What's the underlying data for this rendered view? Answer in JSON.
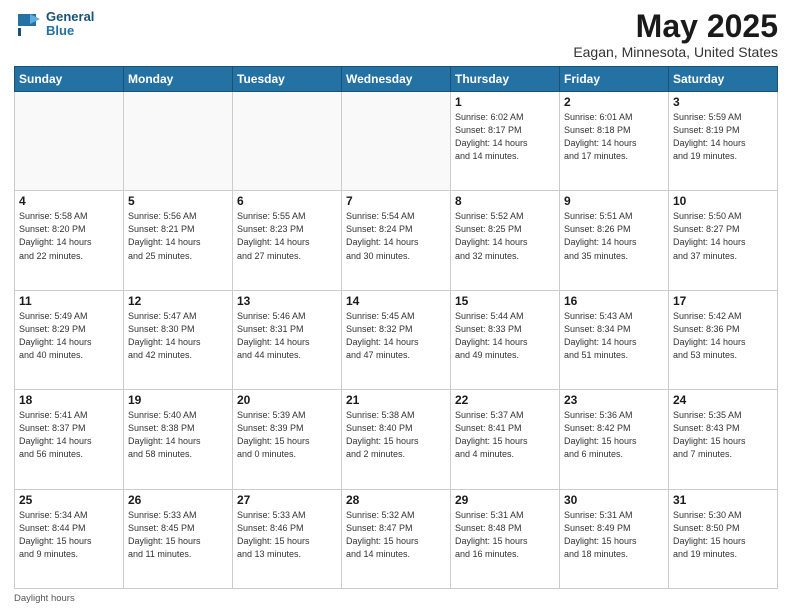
{
  "header": {
    "logo_line1": "General",
    "logo_line2": "Blue",
    "title": "May 2025",
    "location": "Eagan, Minnesota, United States"
  },
  "weekdays": [
    "Sunday",
    "Monday",
    "Tuesday",
    "Wednesday",
    "Thursday",
    "Friday",
    "Saturday"
  ],
  "weeks": [
    [
      {
        "num": "",
        "info": ""
      },
      {
        "num": "",
        "info": ""
      },
      {
        "num": "",
        "info": ""
      },
      {
        "num": "",
        "info": ""
      },
      {
        "num": "1",
        "info": "Sunrise: 6:02 AM\nSunset: 8:17 PM\nDaylight: 14 hours\nand 14 minutes."
      },
      {
        "num": "2",
        "info": "Sunrise: 6:01 AM\nSunset: 8:18 PM\nDaylight: 14 hours\nand 17 minutes."
      },
      {
        "num": "3",
        "info": "Sunrise: 5:59 AM\nSunset: 8:19 PM\nDaylight: 14 hours\nand 19 minutes."
      }
    ],
    [
      {
        "num": "4",
        "info": "Sunrise: 5:58 AM\nSunset: 8:20 PM\nDaylight: 14 hours\nand 22 minutes."
      },
      {
        "num": "5",
        "info": "Sunrise: 5:56 AM\nSunset: 8:21 PM\nDaylight: 14 hours\nand 25 minutes."
      },
      {
        "num": "6",
        "info": "Sunrise: 5:55 AM\nSunset: 8:23 PM\nDaylight: 14 hours\nand 27 minutes."
      },
      {
        "num": "7",
        "info": "Sunrise: 5:54 AM\nSunset: 8:24 PM\nDaylight: 14 hours\nand 30 minutes."
      },
      {
        "num": "8",
        "info": "Sunrise: 5:52 AM\nSunset: 8:25 PM\nDaylight: 14 hours\nand 32 minutes."
      },
      {
        "num": "9",
        "info": "Sunrise: 5:51 AM\nSunset: 8:26 PM\nDaylight: 14 hours\nand 35 minutes."
      },
      {
        "num": "10",
        "info": "Sunrise: 5:50 AM\nSunset: 8:27 PM\nDaylight: 14 hours\nand 37 minutes."
      }
    ],
    [
      {
        "num": "11",
        "info": "Sunrise: 5:49 AM\nSunset: 8:29 PM\nDaylight: 14 hours\nand 40 minutes."
      },
      {
        "num": "12",
        "info": "Sunrise: 5:47 AM\nSunset: 8:30 PM\nDaylight: 14 hours\nand 42 minutes."
      },
      {
        "num": "13",
        "info": "Sunrise: 5:46 AM\nSunset: 8:31 PM\nDaylight: 14 hours\nand 44 minutes."
      },
      {
        "num": "14",
        "info": "Sunrise: 5:45 AM\nSunset: 8:32 PM\nDaylight: 14 hours\nand 47 minutes."
      },
      {
        "num": "15",
        "info": "Sunrise: 5:44 AM\nSunset: 8:33 PM\nDaylight: 14 hours\nand 49 minutes."
      },
      {
        "num": "16",
        "info": "Sunrise: 5:43 AM\nSunset: 8:34 PM\nDaylight: 14 hours\nand 51 minutes."
      },
      {
        "num": "17",
        "info": "Sunrise: 5:42 AM\nSunset: 8:36 PM\nDaylight: 14 hours\nand 53 minutes."
      }
    ],
    [
      {
        "num": "18",
        "info": "Sunrise: 5:41 AM\nSunset: 8:37 PM\nDaylight: 14 hours\nand 56 minutes."
      },
      {
        "num": "19",
        "info": "Sunrise: 5:40 AM\nSunset: 8:38 PM\nDaylight: 14 hours\nand 58 minutes."
      },
      {
        "num": "20",
        "info": "Sunrise: 5:39 AM\nSunset: 8:39 PM\nDaylight: 15 hours\nand 0 minutes."
      },
      {
        "num": "21",
        "info": "Sunrise: 5:38 AM\nSunset: 8:40 PM\nDaylight: 15 hours\nand 2 minutes."
      },
      {
        "num": "22",
        "info": "Sunrise: 5:37 AM\nSunset: 8:41 PM\nDaylight: 15 hours\nand 4 minutes."
      },
      {
        "num": "23",
        "info": "Sunrise: 5:36 AM\nSunset: 8:42 PM\nDaylight: 15 hours\nand 6 minutes."
      },
      {
        "num": "24",
        "info": "Sunrise: 5:35 AM\nSunset: 8:43 PM\nDaylight: 15 hours\nand 7 minutes."
      }
    ],
    [
      {
        "num": "25",
        "info": "Sunrise: 5:34 AM\nSunset: 8:44 PM\nDaylight: 15 hours\nand 9 minutes."
      },
      {
        "num": "26",
        "info": "Sunrise: 5:33 AM\nSunset: 8:45 PM\nDaylight: 15 hours\nand 11 minutes."
      },
      {
        "num": "27",
        "info": "Sunrise: 5:33 AM\nSunset: 8:46 PM\nDaylight: 15 hours\nand 13 minutes."
      },
      {
        "num": "28",
        "info": "Sunrise: 5:32 AM\nSunset: 8:47 PM\nDaylight: 15 hours\nand 14 minutes."
      },
      {
        "num": "29",
        "info": "Sunrise: 5:31 AM\nSunset: 8:48 PM\nDaylight: 15 hours\nand 16 minutes."
      },
      {
        "num": "30",
        "info": "Sunrise: 5:31 AM\nSunset: 8:49 PM\nDaylight: 15 hours\nand 18 minutes."
      },
      {
        "num": "31",
        "info": "Sunrise: 5:30 AM\nSunset: 8:50 PM\nDaylight: 15 hours\nand 19 minutes."
      }
    ]
  ],
  "footer": "Daylight hours"
}
